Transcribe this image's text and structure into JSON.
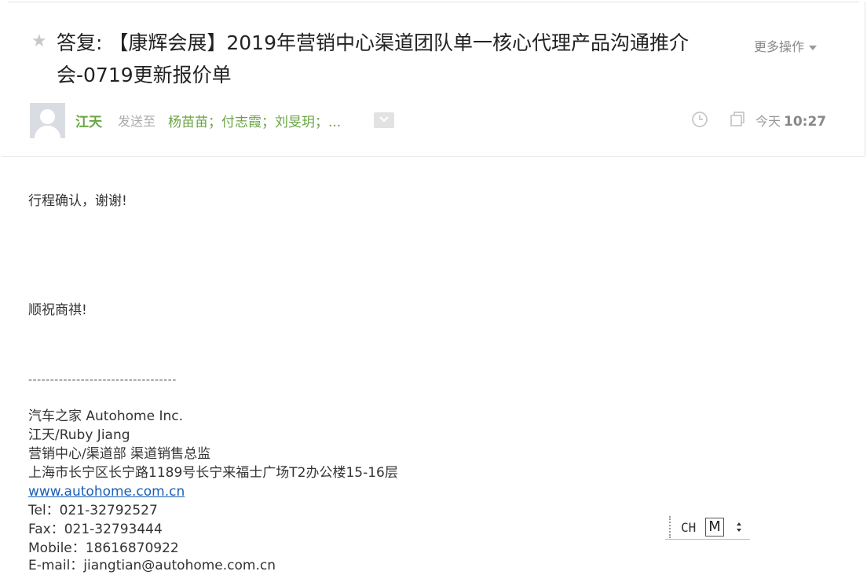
{
  "header": {
    "subject": "答复: 【康辉会展】2019年营销中心渠道团队单一核心代理产品沟通推介会-0719更新报价单",
    "more_actions_label": "更多操作",
    "sender": "江天",
    "sent_to_label": "发送至",
    "recipients": "杨苗苗；付志霞；刘旻玥；...",
    "date_prefix": "今天",
    "time": "10:27"
  },
  "body": {
    "greeting": "行程确认，谢谢!",
    "closing": "顺祝商祺!",
    "separator": "----------------------------------",
    "signature": {
      "company": "汽车之家 Autohome Inc.",
      "name": "江天/Ruby Jiang",
      "title": "营销中心/渠道部 渠道销售总监",
      "address": "上海市长宁区长宁路1189号长宁来福士广场T2办公楼15-16层",
      "website": "www.autohome.com.cn",
      "tel": "Tel：021-32792527",
      "fax": "Fax：021-32793444",
      "mobile": "Mobile：18616870922",
      "email": "E-mail：jiangtian@autohome.com.cn"
    }
  },
  "ime": {
    "lang": "CH",
    "mode": "M"
  },
  "icons": [
    "star-icon",
    "caret-down-icon",
    "avatar",
    "chevron-down-icon",
    "clock-icon",
    "window-icon"
  ],
  "colors": {
    "accent_green": "#6aa544",
    "link_blue": "#1a5fb4"
  }
}
